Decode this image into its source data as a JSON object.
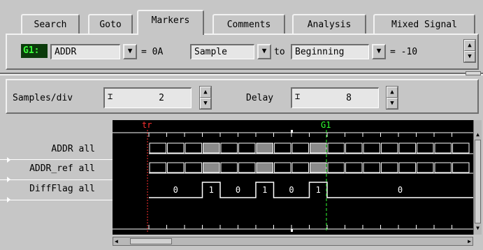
{
  "tabs": [
    {
      "label": "Search",
      "active": false
    },
    {
      "label": "Goto",
      "active": false
    },
    {
      "label": "Markers",
      "active": true
    },
    {
      "label": "Comments",
      "active": false
    },
    {
      "label": "Analysis",
      "active": false
    },
    {
      "label": "Mixed Signal",
      "active": false
    }
  ],
  "marker_panel": {
    "marker_name": "G1:",
    "signal_value": "ADDR",
    "eq_value": "= 0A",
    "reference_value": "Sample",
    "to_label": "to",
    "position_value": "Beginning",
    "offset_value": "= -10"
  },
  "controls": {
    "samples_label": "Samples/div",
    "samples_value": "2",
    "delay_label": "Delay",
    "delay_value": "8"
  },
  "waveform": {
    "markers": [
      {
        "label": "tr",
        "color": "#ff3030"
      },
      {
        "label": "G1",
        "color": "#30ff30"
      }
    ],
    "signals": [
      {
        "label": "ADDR all"
      },
      {
        "label": "ADDR_ref all"
      },
      {
        "label": "DiffFlag all"
      }
    ],
    "diffflag_values": [
      "0",
      "1",
      "0",
      "1",
      "0",
      "1",
      "0"
    ]
  },
  "colors": {
    "background": "#c6c6c6",
    "waveform_bg": "#000000",
    "trace": "#ffffff",
    "trigger_marker": "#ff3030",
    "g1_marker": "#30ff30",
    "bus_fill": "#8a8a8a"
  }
}
